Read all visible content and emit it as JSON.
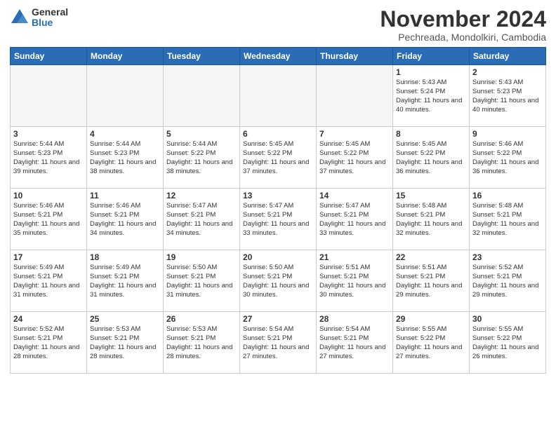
{
  "logo": {
    "general": "General",
    "blue": "Blue"
  },
  "header": {
    "month": "November 2024",
    "location": "Pechreada, Mondolkiri, Cambodia"
  },
  "weekdays": [
    "Sunday",
    "Monday",
    "Tuesday",
    "Wednesday",
    "Thursday",
    "Friday",
    "Saturday"
  ],
  "weeks": [
    [
      {
        "day": "",
        "info": ""
      },
      {
        "day": "",
        "info": ""
      },
      {
        "day": "",
        "info": ""
      },
      {
        "day": "",
        "info": ""
      },
      {
        "day": "",
        "info": ""
      },
      {
        "day": "1",
        "info": "Sunrise: 5:43 AM\nSunset: 5:24 PM\nDaylight: 11 hours\nand 40 minutes."
      },
      {
        "day": "2",
        "info": "Sunrise: 5:43 AM\nSunset: 5:23 PM\nDaylight: 11 hours\nand 40 minutes."
      }
    ],
    [
      {
        "day": "3",
        "info": "Sunrise: 5:44 AM\nSunset: 5:23 PM\nDaylight: 11 hours\nand 39 minutes."
      },
      {
        "day": "4",
        "info": "Sunrise: 5:44 AM\nSunset: 5:23 PM\nDaylight: 11 hours\nand 38 minutes."
      },
      {
        "day": "5",
        "info": "Sunrise: 5:44 AM\nSunset: 5:22 PM\nDaylight: 11 hours\nand 38 minutes."
      },
      {
        "day": "6",
        "info": "Sunrise: 5:45 AM\nSunset: 5:22 PM\nDaylight: 11 hours\nand 37 minutes."
      },
      {
        "day": "7",
        "info": "Sunrise: 5:45 AM\nSunset: 5:22 PM\nDaylight: 11 hours\nand 37 minutes."
      },
      {
        "day": "8",
        "info": "Sunrise: 5:45 AM\nSunset: 5:22 PM\nDaylight: 11 hours\nand 36 minutes."
      },
      {
        "day": "9",
        "info": "Sunrise: 5:46 AM\nSunset: 5:22 PM\nDaylight: 11 hours\nand 36 minutes."
      }
    ],
    [
      {
        "day": "10",
        "info": "Sunrise: 5:46 AM\nSunset: 5:21 PM\nDaylight: 11 hours\nand 35 minutes."
      },
      {
        "day": "11",
        "info": "Sunrise: 5:46 AM\nSunset: 5:21 PM\nDaylight: 11 hours\nand 34 minutes."
      },
      {
        "day": "12",
        "info": "Sunrise: 5:47 AM\nSunset: 5:21 PM\nDaylight: 11 hours\nand 34 minutes."
      },
      {
        "day": "13",
        "info": "Sunrise: 5:47 AM\nSunset: 5:21 PM\nDaylight: 11 hours\nand 33 minutes."
      },
      {
        "day": "14",
        "info": "Sunrise: 5:47 AM\nSunset: 5:21 PM\nDaylight: 11 hours\nand 33 minutes."
      },
      {
        "day": "15",
        "info": "Sunrise: 5:48 AM\nSunset: 5:21 PM\nDaylight: 11 hours\nand 32 minutes."
      },
      {
        "day": "16",
        "info": "Sunrise: 5:48 AM\nSunset: 5:21 PM\nDaylight: 11 hours\nand 32 minutes."
      }
    ],
    [
      {
        "day": "17",
        "info": "Sunrise: 5:49 AM\nSunset: 5:21 PM\nDaylight: 11 hours\nand 31 minutes."
      },
      {
        "day": "18",
        "info": "Sunrise: 5:49 AM\nSunset: 5:21 PM\nDaylight: 11 hours\nand 31 minutes."
      },
      {
        "day": "19",
        "info": "Sunrise: 5:50 AM\nSunset: 5:21 PM\nDaylight: 11 hours\nand 31 minutes."
      },
      {
        "day": "20",
        "info": "Sunrise: 5:50 AM\nSunset: 5:21 PM\nDaylight: 11 hours\nand 30 minutes."
      },
      {
        "day": "21",
        "info": "Sunrise: 5:51 AM\nSunset: 5:21 PM\nDaylight: 11 hours\nand 30 minutes."
      },
      {
        "day": "22",
        "info": "Sunrise: 5:51 AM\nSunset: 5:21 PM\nDaylight: 11 hours\nand 29 minutes."
      },
      {
        "day": "23",
        "info": "Sunrise: 5:52 AM\nSunset: 5:21 PM\nDaylight: 11 hours\nand 29 minutes."
      }
    ],
    [
      {
        "day": "24",
        "info": "Sunrise: 5:52 AM\nSunset: 5:21 PM\nDaylight: 11 hours\nand 28 minutes."
      },
      {
        "day": "25",
        "info": "Sunrise: 5:53 AM\nSunset: 5:21 PM\nDaylight: 11 hours\nand 28 minutes."
      },
      {
        "day": "26",
        "info": "Sunrise: 5:53 AM\nSunset: 5:21 PM\nDaylight: 11 hours\nand 28 minutes."
      },
      {
        "day": "27",
        "info": "Sunrise: 5:54 AM\nSunset: 5:21 PM\nDaylight: 11 hours\nand 27 minutes."
      },
      {
        "day": "28",
        "info": "Sunrise: 5:54 AM\nSunset: 5:21 PM\nDaylight: 11 hours\nand 27 minutes."
      },
      {
        "day": "29",
        "info": "Sunrise: 5:55 AM\nSunset: 5:22 PM\nDaylight: 11 hours\nand 27 minutes."
      },
      {
        "day": "30",
        "info": "Sunrise: 5:55 AM\nSunset: 5:22 PM\nDaylight: 11 hours\nand 26 minutes."
      }
    ]
  ]
}
